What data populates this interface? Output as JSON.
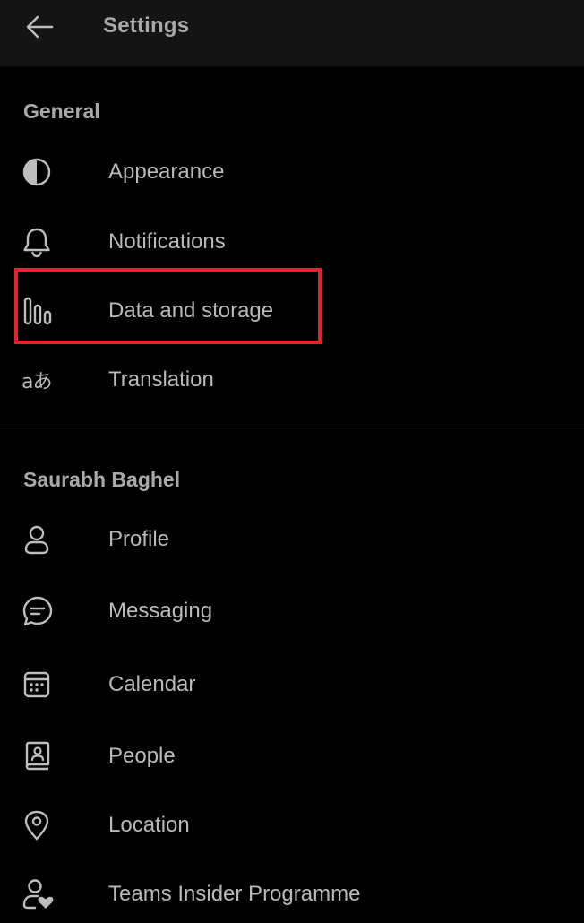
{
  "header": {
    "title": "Settings",
    "back_icon": "arrow-left-icon"
  },
  "sections": {
    "general": {
      "title": "General",
      "items": [
        {
          "label": "Appearance",
          "icon": "half-circle-icon"
        },
        {
          "label": "Notifications",
          "icon": "bell-icon"
        },
        {
          "label": "Data and storage",
          "icon": "data-bars-icon"
        },
        {
          "label": "Translation",
          "icon": "translation-icon",
          "glyph": "aあ"
        }
      ]
    },
    "account": {
      "title": "Saurabh Baghel",
      "items": [
        {
          "label": "Profile",
          "icon": "person-icon"
        },
        {
          "label": "Messaging",
          "icon": "chat-bubble-icon"
        },
        {
          "label": "Calendar",
          "icon": "calendar-icon"
        },
        {
          "label": "People",
          "icon": "contact-card-icon"
        },
        {
          "label": "Location",
          "icon": "map-pin-icon"
        },
        {
          "label": "Teams Insider Programme",
          "icon": "person-heart-icon"
        }
      ]
    }
  },
  "highlight": {
    "target": "Data and storage",
    "color": "#e0232e"
  },
  "colors": {
    "background": "#000000",
    "header_background": "#141414",
    "text": "#b9b9b9",
    "section_text": "#a9a9a9"
  }
}
